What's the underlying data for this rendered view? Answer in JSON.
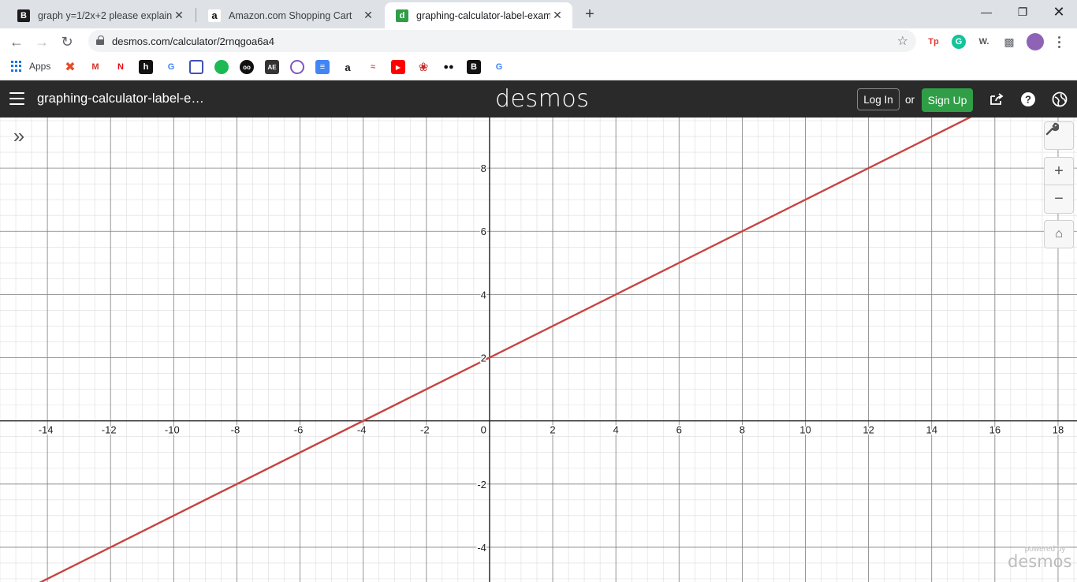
{
  "browser": {
    "tabs": [
      {
        "title": "graph y=1/2x+2 please explain -",
        "favicon": "B",
        "favicon_color": "#1c1c1c",
        "active": false
      },
      {
        "title": "Amazon.com Shopping Cart",
        "favicon": "a",
        "favicon_color": "#ffffff",
        "active": false
      },
      {
        "title": "graphing-calculator-label-examp",
        "favicon": "d",
        "favicon_color": "#2f9e47",
        "active": true
      }
    ],
    "url": "desmos.com/calculator/2rnqgoa6a4",
    "bookmarks": {
      "apps_label": "Apps"
    }
  },
  "desmos": {
    "graph_title": "graphing-calculator-label-e…",
    "logo": "desmos",
    "login_label": "Log In",
    "or_label": "or",
    "signup_label": "Sign Up",
    "powered_by_small": "powered by",
    "powered_by_big": "desmos"
  },
  "colors": {
    "header_bg": "#2a2a2a",
    "signup_green": "#2f9e47",
    "curve": "#c74440"
  },
  "chart_data": {
    "type": "line",
    "xlim": [
      -15.5,
      18.6
    ],
    "ylim": [
      -5.1,
      9.6
    ],
    "grid": true,
    "x_ticks": [
      "-14",
      "-12",
      "-10",
      "-8",
      "-6",
      "-4",
      "-2",
      "0",
      "2",
      "4",
      "6",
      "8",
      "10",
      "12",
      "14",
      "16",
      "18"
    ],
    "y_ticks": [
      "-4",
      "-2",
      "2",
      "4",
      "6",
      "8"
    ],
    "series": [
      {
        "expression": "y=1/2x+2",
        "slope": 0.5,
        "intercept": 2
      }
    ]
  }
}
